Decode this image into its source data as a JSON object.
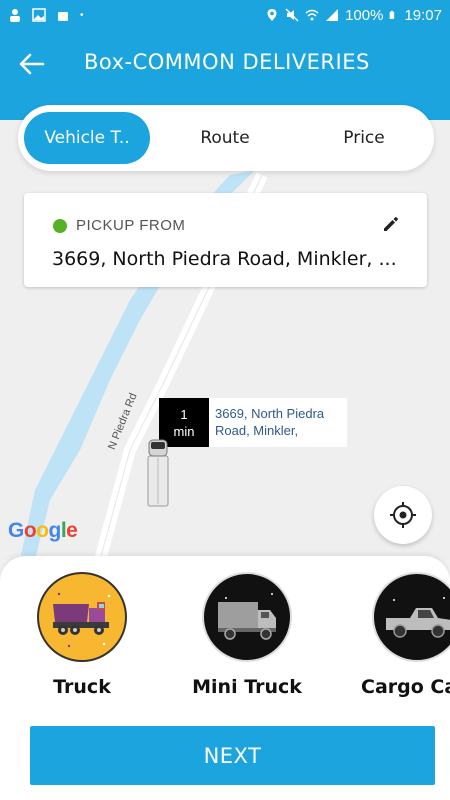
{
  "status_bar": {
    "battery": "100%",
    "time": "19:07"
  },
  "app_bar": {
    "title": "Box-COMMON DELIVERIES"
  },
  "tabs": [
    {
      "label": "Vehicle T..",
      "active": true
    },
    {
      "label": "Route",
      "active": false
    },
    {
      "label": "Price",
      "active": false
    }
  ],
  "pickup": {
    "label": "PICKUP FROM",
    "address": "3669, North Piedra Road, Minkler, ..."
  },
  "map": {
    "road_label": "N Piedra Rd",
    "marker": {
      "eta_value": "1",
      "eta_unit": "min",
      "address": "3669, North Piedra Road, Minkler,"
    },
    "logo": "Google"
  },
  "vehicles": [
    {
      "name": "Truck",
      "selected": true,
      "icon": "dump-truck-icon"
    },
    {
      "name": "Mini Truck",
      "selected": false,
      "icon": "mini-truck-icon"
    },
    {
      "name": "Cargo Ca",
      "selected": false,
      "icon": "pickup-truck-icon"
    }
  ],
  "next_button": {
    "label": "NEXT"
  },
  "colors": {
    "primary": "#1ba4dd",
    "pickup_dot": "#57b125",
    "selected_vehicle_bg": "#f7b731"
  }
}
